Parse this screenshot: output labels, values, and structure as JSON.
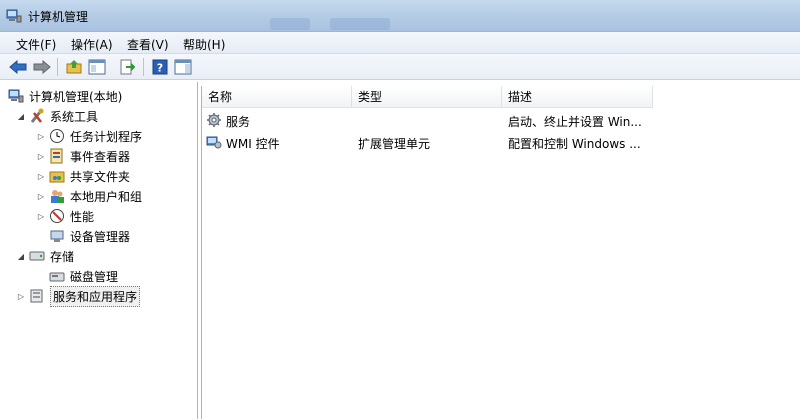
{
  "window": {
    "title": "计算机管理"
  },
  "menu": [
    {
      "label": "文件(F)"
    },
    {
      "label": "操作(A)"
    },
    {
      "label": "查看(V)"
    },
    {
      "label": "帮助(H)"
    }
  ],
  "toolbar": {
    "buttons": [
      {
        "icon": "back-arrow-icon"
      },
      {
        "icon": "forward-arrow-icon"
      },
      {
        "icon": "up-folder-icon"
      },
      {
        "icon": "show-hide-tree-icon"
      },
      {
        "icon": "export-list-icon"
      },
      {
        "icon": "help-icon"
      },
      {
        "icon": "action-pane-icon"
      }
    ]
  },
  "tree": {
    "root": "计算机管理(本地)",
    "system_tools": "系统工具",
    "task_scheduler": "任务计划程序",
    "event_viewer": "事件查看器",
    "shared_folders": "共享文件夹",
    "local_users": "本地用户和组",
    "performance": "性能",
    "device_manager": "设备管理器",
    "storage": "存储",
    "disk_management": "磁盘管理",
    "services_apps": "服务和应用程序"
  },
  "list": {
    "columns": [
      "名称",
      "类型",
      "描述"
    ],
    "rows": [
      {
        "name": "服务",
        "type": "",
        "desc": "启动、终止并设置 Win..."
      },
      {
        "name": "WMI 控件",
        "type": "扩展管理单元",
        "desc": "配置和控制 Windows ..."
      }
    ]
  }
}
